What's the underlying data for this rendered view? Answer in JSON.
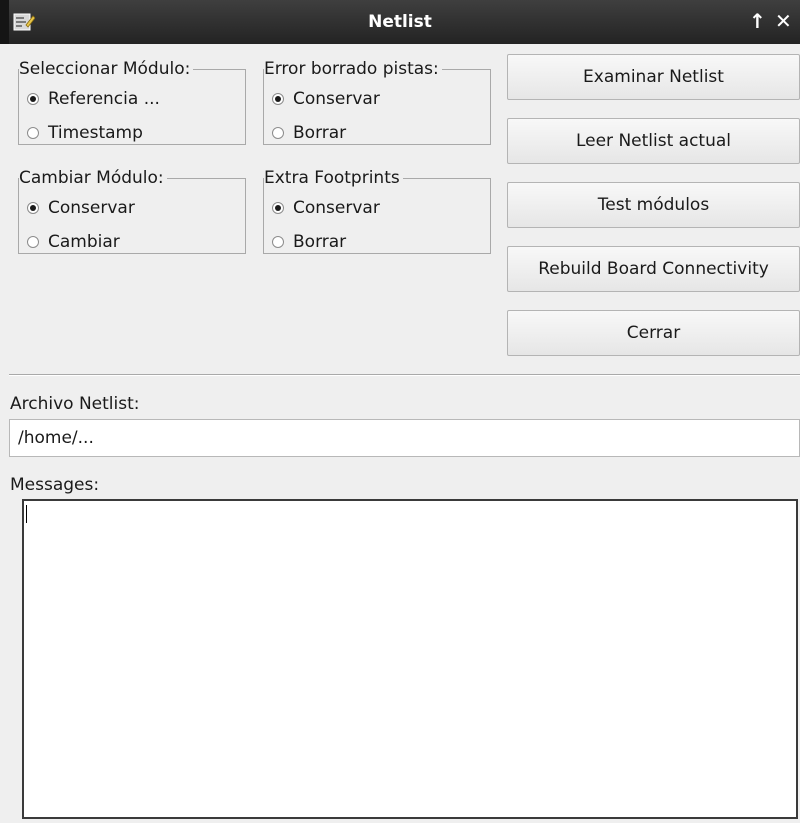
{
  "window": {
    "title": "Netlist",
    "maximize_glyph": "↑",
    "close_glyph": "✕",
    "app_icon": "netlist-app-icon"
  },
  "groups": {
    "select_module": {
      "legend": "Seleccionar Módulo:",
      "options": [
        "Referencia ...",
        "Timestamp"
      ],
      "selected": "Referencia ..."
    },
    "error_delete_tracks": {
      "legend": "Error borrado pistas:",
      "options": [
        "Conservar",
        "Borrar"
      ],
      "selected": "Conservar"
    },
    "change_module": {
      "legend": "Cambiar Módulo:",
      "options": [
        "Conservar",
        "Cambiar"
      ],
      "selected": "Conservar"
    },
    "extra_footprints": {
      "legend": "Extra Footprints",
      "options": [
        "Conservar",
        "Borrar"
      ],
      "selected": "Conservar"
    }
  },
  "buttons": {
    "browse": "Examinar Netlist",
    "read": "Leer Netlist actual",
    "test": "Test módulos",
    "rebuild": "Rebuild Board Connectivity",
    "close": "Cerrar"
  },
  "netlist_file": {
    "label": "Archivo Netlist:",
    "value": "/home/..."
  },
  "messages": {
    "label": "Messages:",
    "text": ""
  }
}
